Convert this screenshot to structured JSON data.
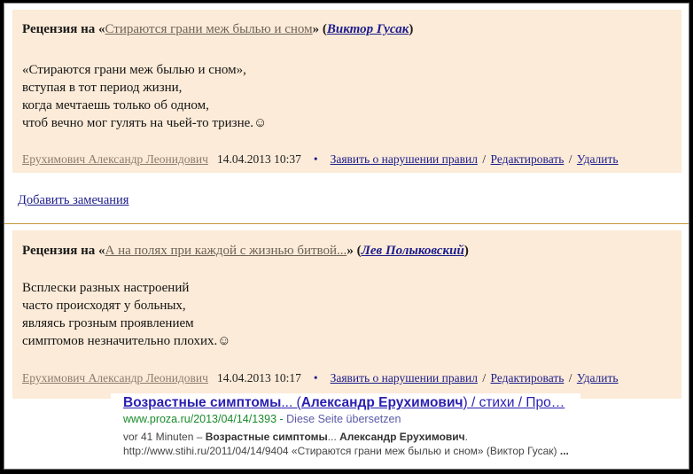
{
  "reviews": [
    {
      "prefix": "Рецензия на «",
      "work": "Стираются грани меж былью и сном",
      "mid": "» (",
      "author": "Виктор Гусак",
      "suffix": ")",
      "lines": [
        "«Стираются грани меж былью и сном»,",
        "вступая в тот период жизни,",
        "когда мечтаешь только об одном,",
        "чтоб вечно мог гулять на чьей-то тризне.☺"
      ],
      "user": "Ерухимович Александр Леонидович",
      "date": "14.04.2013 10:37",
      "bullet": "•",
      "report": "Заявить о нарушении правил",
      "edit": "Редактировать",
      "delete": "Удалить",
      "sep": "/"
    },
    {
      "prefix": "Рецензия на «",
      "work": "А на полях при каждой с жизнью битвой...",
      "mid": "» (",
      "author": "Лев Полыковский",
      "suffix": ")",
      "lines": [
        "Всплески разных настроений",
        "часто происходят у больных,",
        "являясь грозным проявлением",
        "симптомов незначительно плохих.☺"
      ],
      "user": "Ерухимович Александр Леонидович",
      "date": "14.04.2013 10:17",
      "bullet": "•",
      "report": "Заявить о нарушении правил",
      "edit": "Редактировать",
      "delete": "Удалить",
      "sep": "/"
    }
  ],
  "add_remarks": "Добавить замечания",
  "snippet": {
    "title_bold": "Возрастные симптомы",
    "title_mid": "... (",
    "title_bold2": "Александр Ерухимович",
    "title_end": ") / стихи / Про…",
    "url": "www.proza.ru/2013/04/14/1393",
    "url_sep": " - ",
    "translate": "Diese Seite übersetzen",
    "desc_prefix": "vor 41 Minuten – ",
    "desc_bold1": "Возрастные симптомы",
    "desc_mid1": "... ",
    "desc_bold2": "Александр Ерухимович",
    "desc_mid2": ". http://www.stihi.ru/2011/04/14/9404 «Стираются грани меж былью и сном» (Виктор Гусак) ",
    "desc_bold3": "..."
  },
  "colors": {
    "review_bg": "#fcebd8",
    "link": "#1c1c8c",
    "divider": "#c49a3a",
    "snippet_title": "#2a1fb0",
    "snippet_url": "#1a8a2a"
  }
}
